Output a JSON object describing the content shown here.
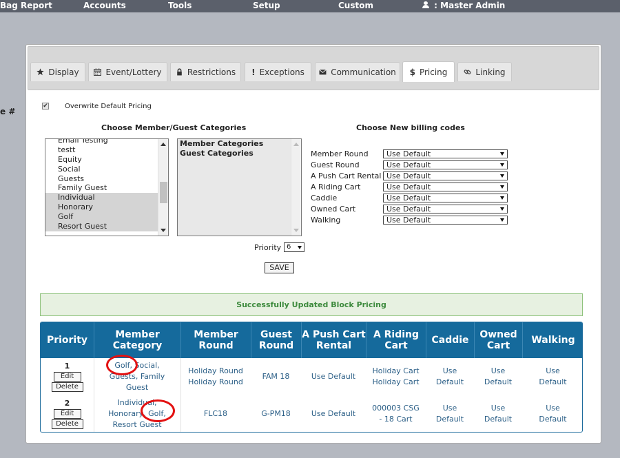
{
  "topbar": {
    "items": [
      "Bag Report",
      "Accounts",
      "Tools",
      "Setup",
      "Custom"
    ],
    "user_label": " : Master Admin"
  },
  "side_hash": "e #",
  "tabs": [
    {
      "label": "Display",
      "icon": "star-icon"
    },
    {
      "label": "Event/Lottery",
      "icon": "calendar-icon"
    },
    {
      "label": "Restrictions",
      "icon": "lock-icon"
    },
    {
      "label": "Exceptions",
      "icon": "exclamation-icon"
    },
    {
      "label": "Communication",
      "icon": "envelope-icon"
    },
    {
      "label": "Pricing",
      "icon": "dollar-icon",
      "active": true
    },
    {
      "label": "Linking",
      "icon": "link-icon"
    }
  ],
  "overwrite": {
    "checked": true,
    "label": "Overwrite Default Pricing"
  },
  "categories_heading": "Choose Member/Guest Categories",
  "billing_heading": "Choose New billing codes",
  "category_list": [
    {
      "label": "Email Testing",
      "selected": false
    },
    {
      "label": "testt",
      "selected": false
    },
    {
      "label": "Equity",
      "selected": false
    },
    {
      "label": "Social",
      "selected": false
    },
    {
      "label": "Guests",
      "selected": false
    },
    {
      "label": "Family Guest",
      "selected": false
    },
    {
      "label": "Individual",
      "selected": true
    },
    {
      "label": "Honorary",
      "selected": true
    },
    {
      "label": "Golf",
      "selected": true
    },
    {
      "label": "Resort Guest",
      "selected": true
    }
  ],
  "group_list": [
    "Member Categories",
    "Guest Categories"
  ],
  "billing_codes": [
    {
      "label": "Member Round",
      "value": "Use Default"
    },
    {
      "label": "Guest Round",
      "value": "Use Default"
    },
    {
      "label": "A Push Cart Rental",
      "value": "Use Default"
    },
    {
      "label": "A Riding Cart",
      "value": "Use Default"
    },
    {
      "label": "Caddie",
      "value": "Use Default"
    },
    {
      "label": "Owned Cart",
      "value": "Use Default"
    },
    {
      "label": "Walking",
      "value": "Use Default"
    }
  ],
  "priority": {
    "label": "Priority",
    "value": "6"
  },
  "save_label": "SAVE",
  "success_message": "Successfully Updated Block Pricing",
  "table": {
    "headers": [
      "Priority",
      "Member Category",
      "Member Round",
      "Guest Round",
      "A Push Cart Rental",
      "A Riding Cart",
      "Caddie",
      "Owned Cart",
      "Walking"
    ],
    "rows": [
      {
        "priority": "1",
        "edit": "Edit",
        "delete": "Delete",
        "member_category": [
          "Golf, Social,",
          "Guests, Family",
          "Guest"
        ],
        "member_round": [
          "Holiday Round",
          "Holiday Round"
        ],
        "guest_round": [
          "FAM 18"
        ],
        "push_cart": [
          "Use Default"
        ],
        "riding_cart": [
          "Holiday Cart",
          "Holiday Cart"
        ],
        "caddie": [
          "Use",
          "Default"
        ],
        "owned_cart": [
          "Use",
          "Default"
        ],
        "walking": [
          "Use",
          "Default"
        ]
      },
      {
        "priority": "2",
        "edit": "Edit",
        "delete": "Delete",
        "member_category": [
          "Individual,",
          "Honorary, Golf,",
          "Resort Guest"
        ],
        "member_round": [
          "FLC18"
        ],
        "guest_round": [
          "G-PM18"
        ],
        "push_cart": [
          "Use Default"
        ],
        "riding_cart": [
          "000003 CSG",
          "- 18 Cart"
        ],
        "caddie": [
          "Use",
          "Default"
        ],
        "owned_cart": [
          "Use",
          "Default"
        ],
        "walking": [
          "Use",
          "Default"
        ]
      }
    ]
  },
  "colors": {
    "header_blue": "#156a9c",
    "success_green": "#3d8a3d",
    "annotation_red": "#e31111"
  }
}
